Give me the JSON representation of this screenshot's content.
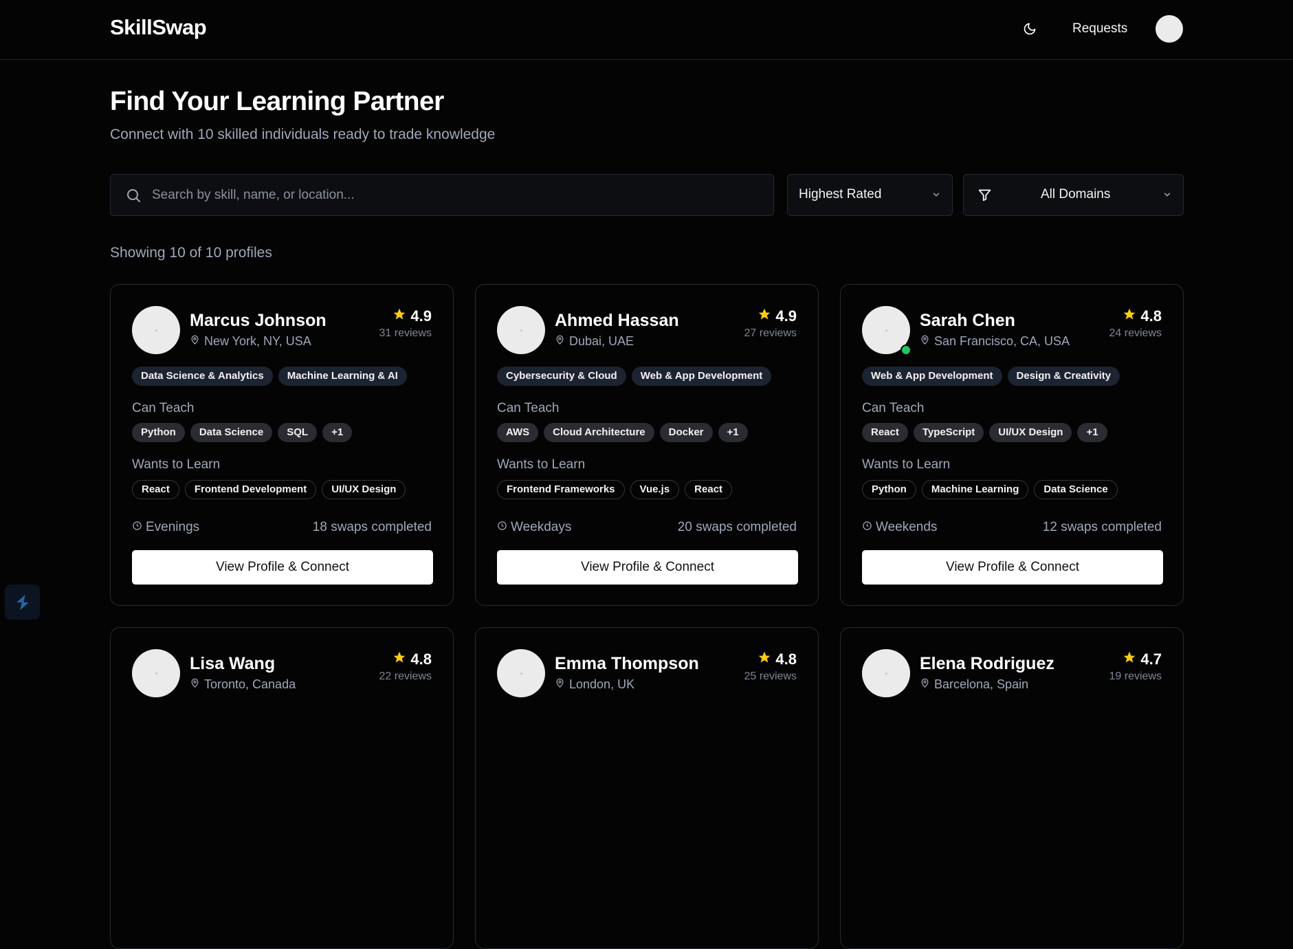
{
  "app": {
    "brand": "SkillSwap"
  },
  "nav": {
    "requests_label": "Requests"
  },
  "hero": {
    "title": "Find Your Learning Partner",
    "subtitle": "Connect with 10 skilled individuals ready to trade knowledge"
  },
  "filters": {
    "search_placeholder": "Search by skill, name, or location...",
    "sort_value": "Highest Rated",
    "domain_value": "All Domains"
  },
  "results": {
    "count_text": "Showing 10 of 10 profiles"
  },
  "colors": {
    "background": "#040405",
    "accent_star": "#facc15",
    "online": "#22c55e",
    "domain_tag": "#1c2331"
  },
  "profiles": [
    {
      "name": "Marcus Johnson",
      "location": "New York, NY, USA",
      "rating": "4.9",
      "reviews": "31 reviews",
      "online": false,
      "domains": [
        "Data Science & Analytics",
        "Machine Learning & AI"
      ],
      "teach_label": "Can Teach",
      "teach": [
        "Python",
        "Data Science",
        "SQL",
        "+1"
      ],
      "learn_label": "Wants to Learn",
      "learn": [
        "React",
        "Frontend Development",
        "UI/UX Design"
      ],
      "availability": "Evenings",
      "swaps": "18 swaps completed",
      "cta": "View Profile & Connect"
    },
    {
      "name": "Ahmed Hassan",
      "location": "Dubai, UAE",
      "rating": "4.9",
      "reviews": "27 reviews",
      "online": false,
      "domains": [
        "Cybersecurity & Cloud",
        "Web & App Development"
      ],
      "teach_label": "Can Teach",
      "teach": [
        "AWS",
        "Cloud Architecture",
        "Docker",
        "+1"
      ],
      "learn_label": "Wants to Learn",
      "learn": [
        "Frontend Frameworks",
        "Vue.js",
        "React"
      ],
      "availability": "Weekdays",
      "swaps": "20 swaps completed",
      "cta": "View Profile & Connect"
    },
    {
      "name": "Sarah Chen",
      "location": "San Francisco, CA, USA",
      "rating": "4.8",
      "reviews": "24 reviews",
      "online": true,
      "domains": [
        "Web & App Development",
        "Design & Creativity"
      ],
      "teach_label": "Can Teach",
      "teach": [
        "React",
        "TypeScript",
        "UI/UX Design",
        "+1"
      ],
      "learn_label": "Wants to Learn",
      "learn": [
        "Python",
        "Machine Learning",
        "Data Science"
      ],
      "availability": "Weekends",
      "swaps": "12 swaps completed",
      "cta": "View Profile & Connect"
    },
    {
      "name": "Lisa Wang",
      "location": "Toronto, Canada",
      "rating": "4.8",
      "reviews": "22 reviews",
      "online": false,
      "domains": [],
      "teach_label": "",
      "teach": [],
      "learn_label": "",
      "learn": [],
      "availability": "",
      "swaps": "",
      "cta": ""
    },
    {
      "name": "Emma Thompson",
      "location": "London, UK",
      "rating": "4.8",
      "reviews": "25 reviews",
      "online": false,
      "domains": [],
      "teach_label": "",
      "teach": [],
      "learn_label": "",
      "learn": [],
      "availability": "",
      "swaps": "",
      "cta": ""
    },
    {
      "name": "Elena Rodriguez",
      "location": "Barcelona, Spain",
      "rating": "4.7",
      "reviews": "19 reviews",
      "online": false,
      "domains": [],
      "teach_label": "",
      "teach": [],
      "learn_label": "",
      "learn": [],
      "availability": "",
      "swaps": "",
      "cta": ""
    }
  ]
}
